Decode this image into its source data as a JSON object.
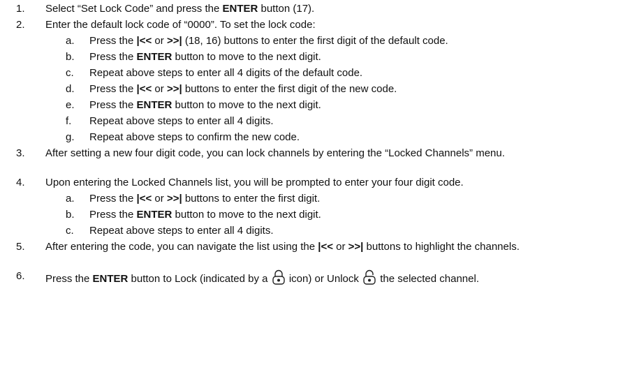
{
  "steps": [
    {
      "num": "1.",
      "parts": [
        "Select “Set Lock Code” and press the ",
        "ENTER",
        " button (17)."
      ]
    },
    {
      "num": "2.",
      "text": "Enter the default lock code of “0000”. To set the lock code:",
      "substeps": [
        {
          "letter": "a.",
          "parts": [
            "Press the ",
            "|<<",
            " or ",
            ">>|",
            " (18, 16) buttons to enter the first digit of the default code."
          ]
        },
        {
          "letter": "b.",
          "parts": [
            "Press the ",
            "ENTER",
            " button to move to the next digit."
          ]
        },
        {
          "letter": "c.",
          "text": "Repeat above steps to enter all 4 digits of the default code."
        },
        {
          "letter": "d.",
          "parts": [
            "Press the ",
            "|<<",
            " or ",
            ">>|",
            " buttons to enter the first digit of the new code."
          ]
        },
        {
          "letter": "e.",
          "parts": [
            "Press the ",
            "ENTER",
            " button to move to the next digit."
          ]
        },
        {
          "letter": "f.",
          "text": "Repeat above steps to enter all 4 digits."
        },
        {
          "letter": "g.",
          "text": "Repeat above steps to confirm the new code."
        }
      ]
    },
    {
      "num": "3.",
      "text": "After setting a new four digit code, you can lock channels by entering the “Locked Channels” menu."
    },
    {
      "num": "4.",
      "text": "Upon entering the Locked Channels list, you will be prompted to enter your four digit code.",
      "substeps": [
        {
          "letter": "a.",
          "parts": [
            "Press the ",
            "|<<",
            " or ",
            ">>|",
            " buttons to enter the first digit."
          ]
        },
        {
          "letter": "b.",
          "parts": [
            "Press the ",
            "ENTER",
            " button to move to the next digit."
          ]
        },
        {
          "letter": "c.",
          "text": "Repeat above steps to enter all 4 digits."
        }
      ]
    },
    {
      "num": "5.",
      "parts": [
        "After entering the code, you can navigate the list using the ",
        "|<<",
        " or ",
        ">>|",
        " buttons to highlight the channels."
      ]
    },
    {
      "num": "6.",
      "parts": [
        "Press the ",
        "ENTER",
        " button to Lock (indicated by a ",
        " icon) or Unlock ",
        " the selected channel."
      ],
      "icons": [
        "lock-closed",
        "lock-open"
      ]
    }
  ]
}
